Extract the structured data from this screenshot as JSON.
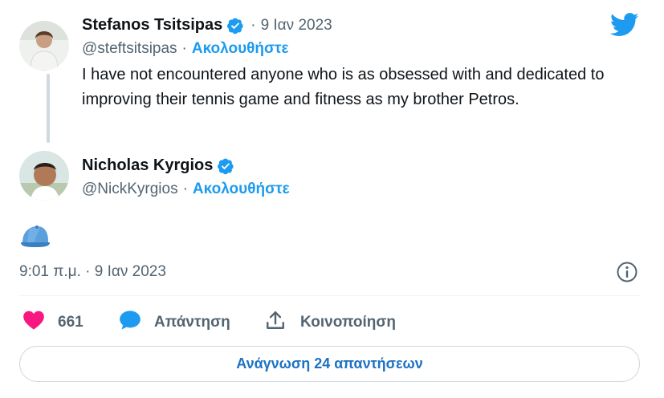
{
  "colors": {
    "brand_blue": "#1d9bf0",
    "like_pink": "#f91880",
    "text_primary": "#0f1419",
    "text_muted": "#536471",
    "thread_line": "#cfd9de"
  },
  "twitter_logo": {
    "icon": "twitter-bird-icon"
  },
  "quoted_tweet": {
    "author": {
      "display_name": "Stefanos Tsitsipas",
      "verified_icon": "verified-badge-icon",
      "handle": "@steftsitsipas",
      "follow_label": "Ακολουθήστε"
    },
    "date_separator": "·",
    "date": "9 Ιαν 2023",
    "text": "I have not encountered anyone who is as obsessed with and dedicated to improving their tennis game and fitness as my brother Petros."
  },
  "reply_tweet": {
    "author": {
      "display_name": "Nicholas Kyrgios",
      "verified_icon": "verified-badge-icon",
      "handle": "@NickKyrgios",
      "separator": "·",
      "follow_label": "Ακολουθήστε"
    },
    "content_emoji": "cap-emoji-icon",
    "timestamp": "9:01 π.μ. · 9 Ιαν 2023",
    "info_icon": "info-icon"
  },
  "actions": {
    "like_count": "661",
    "reply_label": "Απάντηση",
    "share_label": "Κοινοποίηση"
  },
  "read_replies_label": "Ανάγνωση 24 απαντήσεων"
}
